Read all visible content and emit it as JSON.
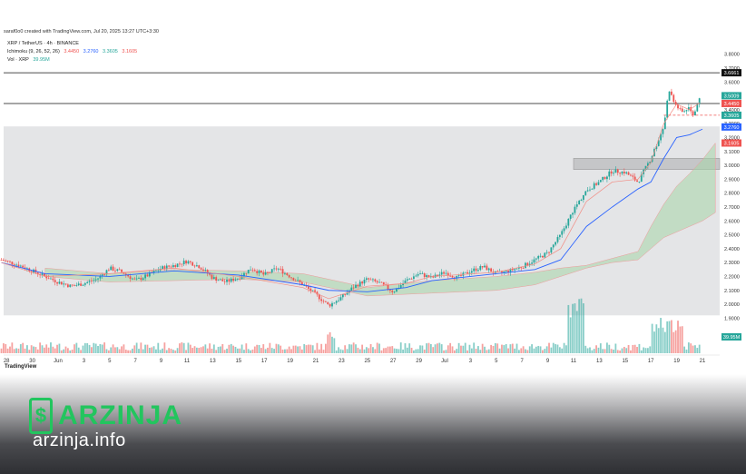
{
  "header": {
    "created_by": "saraf0o0 created with TradingView.com, Jul 20, 2025 13:27 UTC+3:30"
  },
  "legend": {
    "symbol": "XRP / TetherUS · 4h · BINANCE",
    "ichimoku_label": "Ichimoku (9, 26, 52, 26)",
    "ichimoku_values": [
      "3.4450",
      "3.2760",
      "3.3605",
      "3.1605"
    ],
    "vol_label": "Vol · XRP",
    "vol_value": "39.95M"
  },
  "colors": {
    "up": "#26a69a",
    "down": "#ef5350",
    "base": "#2962ff",
    "conv": "#f28b82",
    "cloud": "#a5d6a7"
  },
  "chart_data": {
    "type": "candlestick",
    "symbol": "XRP / TetherUS",
    "interval": "4h",
    "ylim": [
      1.85,
      3.85
    ],
    "y_ticks": [
      "3.8000",
      "3.7000",
      "3.6000",
      "3.5000",
      "3.4000",
      "3.3000",
      "3.2000",
      "3.1000",
      "3.0000",
      "2.9000",
      "2.8000",
      "2.7000",
      "2.6000",
      "2.5000",
      "2.4000",
      "2.3000",
      "2.2000",
      "2.1000",
      "2.0000",
      "1.9000"
    ],
    "x_ticks": [
      {
        "label": "28",
        "day": -3
      },
      {
        "label": "30",
        "day": -1
      },
      {
        "label": "Jun",
        "day": 1
      },
      {
        "label": "3",
        "day": 3
      },
      {
        "label": "5",
        "day": 5
      },
      {
        "label": "7",
        "day": 7
      },
      {
        "label": "9",
        "day": 9
      },
      {
        "label": "11",
        "day": 11
      },
      {
        "label": "13",
        "day": 13
      },
      {
        "label": "15",
        "day": 15
      },
      {
        "label": "17",
        "day": 17
      },
      {
        "label": "19",
        "day": 19
      },
      {
        "label": "21",
        "day": 21
      },
      {
        "label": "23",
        "day": 23
      },
      {
        "label": "25",
        "day": 25
      },
      {
        "label": "27",
        "day": 27
      },
      {
        "label": "29",
        "day": 29
      },
      {
        "label": "Jul",
        "day": 31
      },
      {
        "label": "3",
        "day": 33
      },
      {
        "label": "5",
        "day": 35
      },
      {
        "label": "7",
        "day": 37
      },
      {
        "label": "9",
        "day": 39
      },
      {
        "label": "11",
        "day": 41
      },
      {
        "label": "13",
        "day": 43
      },
      {
        "label": "15",
        "day": 45
      },
      {
        "label": "17",
        "day": 47
      },
      {
        "label": "19",
        "day": 49
      },
      {
        "label": "21",
        "day": 51
      }
    ],
    "close_points": [
      [
        -3.4,
        2.32
      ],
      [
        -2,
        2.28
      ],
      [
        -1,
        2.24
      ],
      [
        0,
        2.2
      ],
      [
        1,
        2.16
      ],
      [
        2,
        2.13
      ],
      [
        3,
        2.15
      ],
      [
        4,
        2.18
      ],
      [
        5,
        2.26
      ],
      [
        6,
        2.23
      ],
      [
        7,
        2.17
      ],
      [
        8,
        2.21
      ],
      [
        9,
        2.26
      ],
      [
        10,
        2.28
      ],
      [
        11,
        2.31
      ],
      [
        12,
        2.27
      ],
      [
        13,
        2.19
      ],
      [
        14,
        2.16
      ],
      [
        15,
        2.19
      ],
      [
        16,
        2.26
      ],
      [
        17,
        2.21
      ],
      [
        18,
        2.26
      ],
      [
        19,
        2.2
      ],
      [
        20,
        2.14
      ],
      [
        21,
        2.07
      ],
      [
        22,
        1.99
      ],
      [
        23,
        2.05
      ],
      [
        24,
        2.13
      ],
      [
        25,
        2.18
      ],
      [
        26,
        2.15
      ],
      [
        27,
        2.09
      ],
      [
        28,
        2.17
      ],
      [
        29,
        2.22
      ],
      [
        30,
        2.19
      ],
      [
        31,
        2.23
      ],
      [
        32,
        2.19
      ],
      [
        33,
        2.24
      ],
      [
        34,
        2.27
      ],
      [
        35,
        2.22
      ],
      [
        36,
        2.24
      ],
      [
        37,
        2.27
      ],
      [
        38,
        2.32
      ],
      [
        39,
        2.37
      ],
      [
        40,
        2.5
      ],
      [
        41,
        2.68
      ],
      [
        42,
        2.82
      ],
      [
        43,
        2.88
      ],
      [
        44,
        2.96
      ],
      [
        45,
        2.95
      ],
      [
        46,
        2.88
      ],
      [
        47,
        3.05
      ],
      [
        48,
        3.28
      ],
      [
        48.4,
        3.55
      ],
      [
        48.8,
        3.45
      ],
      [
        49.4,
        3.38
      ],
      [
        50,
        3.42
      ],
      [
        50.3,
        3.36
      ],
      [
        50.8,
        3.5
      ]
    ],
    "kijun_points": [
      [
        -3.4,
        2.3
      ],
      [
        0,
        2.22
      ],
      [
        5,
        2.2
      ],
      [
        10,
        2.24
      ],
      [
        15,
        2.21
      ],
      [
        20,
        2.14
      ],
      [
        22,
        2.1
      ],
      [
        25,
        2.09
      ],
      [
        28,
        2.12
      ],
      [
        30,
        2.17
      ],
      [
        35,
        2.22
      ],
      [
        38,
        2.25
      ],
      [
        40,
        2.32
      ],
      [
        42,
        2.56
      ],
      [
        44,
        2.7
      ],
      [
        46,
        2.83
      ],
      [
        47,
        2.88
      ],
      [
        48,
        3.05
      ],
      [
        49,
        3.2
      ],
      [
        50,
        3.22
      ],
      [
        51,
        3.26
      ]
    ],
    "tenkan_points": [
      [
        -3.4,
        2.3
      ],
      [
        0,
        2.2
      ],
      [
        5,
        2.22
      ],
      [
        10,
        2.26
      ],
      [
        15,
        2.2
      ],
      [
        20,
        2.12
      ],
      [
        22,
        2.04
      ],
      [
        25,
        2.13
      ],
      [
        28,
        2.15
      ],
      [
        30,
        2.2
      ],
      [
        35,
        2.23
      ],
      [
        38,
        2.29
      ],
      [
        40,
        2.4
      ],
      [
        42,
        2.74
      ],
      [
        44,
        2.88
      ],
      [
        46,
        2.9
      ],
      [
        47,
        3.02
      ],
      [
        48,
        3.3
      ],
      [
        49,
        3.44
      ],
      [
        50,
        3.4
      ],
      [
        50.8,
        3.45
      ]
    ],
    "cloud_top": [
      [
        0,
        2.26
      ],
      [
        5,
        2.22
      ],
      [
        10,
        2.25
      ],
      [
        15,
        2.24
      ],
      [
        20,
        2.22
      ],
      [
        25,
        2.12
      ],
      [
        30,
        2.17
      ],
      [
        35,
        2.2
      ],
      [
        38,
        2.23
      ],
      [
        40,
        2.26
      ],
      [
        42,
        2.28
      ],
      [
        44,
        2.33
      ],
      [
        46,
        2.38
      ],
      [
        47,
        2.56
      ],
      [
        48,
        2.72
      ],
      [
        49,
        2.85
      ],
      [
        50,
        2.94
      ],
      [
        51,
        3.04
      ],
      [
        52,
        3.16
      ]
    ],
    "cloud_bottom": [
      [
        0,
        2.2
      ],
      [
        5,
        2.16
      ],
      [
        10,
        2.17
      ],
      [
        15,
        2.18
      ],
      [
        20,
        2.16
      ],
      [
        25,
        2.06
      ],
      [
        30,
        2.08
      ],
      [
        35,
        2.1
      ],
      [
        38,
        2.14
      ],
      [
        40,
        2.2
      ],
      [
        42,
        2.26
      ],
      [
        44,
        2.3
      ],
      [
        46,
        2.32
      ],
      [
        47,
        2.4
      ],
      [
        48,
        2.48
      ],
      [
        49,
        2.52
      ],
      [
        50,
        2.56
      ],
      [
        51,
        2.6
      ],
      [
        52,
        2.66
      ]
    ],
    "horizontal_lines": [
      3.6661,
      3.445
    ],
    "dashed_line": 3.3605,
    "resistance_zone": [
      2.97,
      3.05
    ],
    "price_labels": [
      {
        "text": "3.6661",
        "value": 3.6661,
        "color": "#111111"
      },
      {
        "text": "3.5009",
        "value": 3.5009,
        "color": "#26a69a"
      },
      {
        "text": "3.4450",
        "value": 3.445,
        "color": "#ef5350"
      },
      {
        "text": "3.3605",
        "value": 3.3605,
        "color": "#26a69a"
      },
      {
        "text": "3.2760",
        "value": 3.276,
        "color": "#2962ff"
      },
      {
        "text": "3.1605",
        "value": 3.1605,
        "color": "#ef5350"
      }
    ],
    "volume_label": "39.95M"
  },
  "footer": {
    "logo_glyph": "$",
    "brand": "ARZINJA",
    "domain": "arzinja.info",
    "tradingview": "TradingView"
  }
}
